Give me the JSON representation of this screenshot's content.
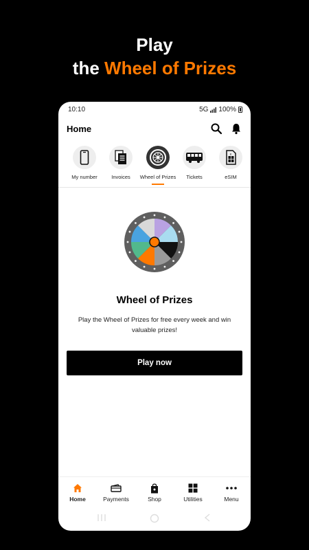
{
  "promo": {
    "line1": "Play",
    "line2_prefix": "the ",
    "line2_accent": "Wheel of Prizes"
  },
  "status_bar": {
    "time": "10:10",
    "network": "5G",
    "battery": "100%"
  },
  "header": {
    "title": "Home",
    "search_icon": "search-icon",
    "bell_icon": "bell-icon"
  },
  "shortcuts": [
    {
      "label": "My number",
      "icon": "phone-icon"
    },
    {
      "label": "Invoices",
      "icon": "invoice-icon"
    },
    {
      "label": "Wheel of Prizes",
      "icon": "wheel-icon",
      "active": true
    },
    {
      "label": "Tickets",
      "icon": "bus-icon"
    },
    {
      "label": "eSIM",
      "icon": "esim-icon"
    }
  ],
  "wheel_colors": [
    "#b9a2e2",
    "#a9dcf0",
    "#111111",
    "#9a9a9a",
    "#ff7900",
    "#52b98c",
    "#4aa3e0",
    "#d9d9d9"
  ],
  "content": {
    "title": "Wheel of Prizes",
    "description": "Play the Wheel of Prizes for free every week and win valuable prizes!",
    "button_label": "Play now"
  },
  "bottom_nav": [
    {
      "label": "Home",
      "icon": "home-icon",
      "active": true
    },
    {
      "label": "Payments",
      "icon": "wallet-icon"
    },
    {
      "label": "Shop",
      "icon": "shopping-bag-icon"
    },
    {
      "label": "Utilities",
      "icon": "grid-icon"
    },
    {
      "label": "Menu",
      "icon": "more-icon"
    }
  ],
  "colors": {
    "accent": "#ff7900",
    "background": "#000000",
    "button": "#000000"
  }
}
